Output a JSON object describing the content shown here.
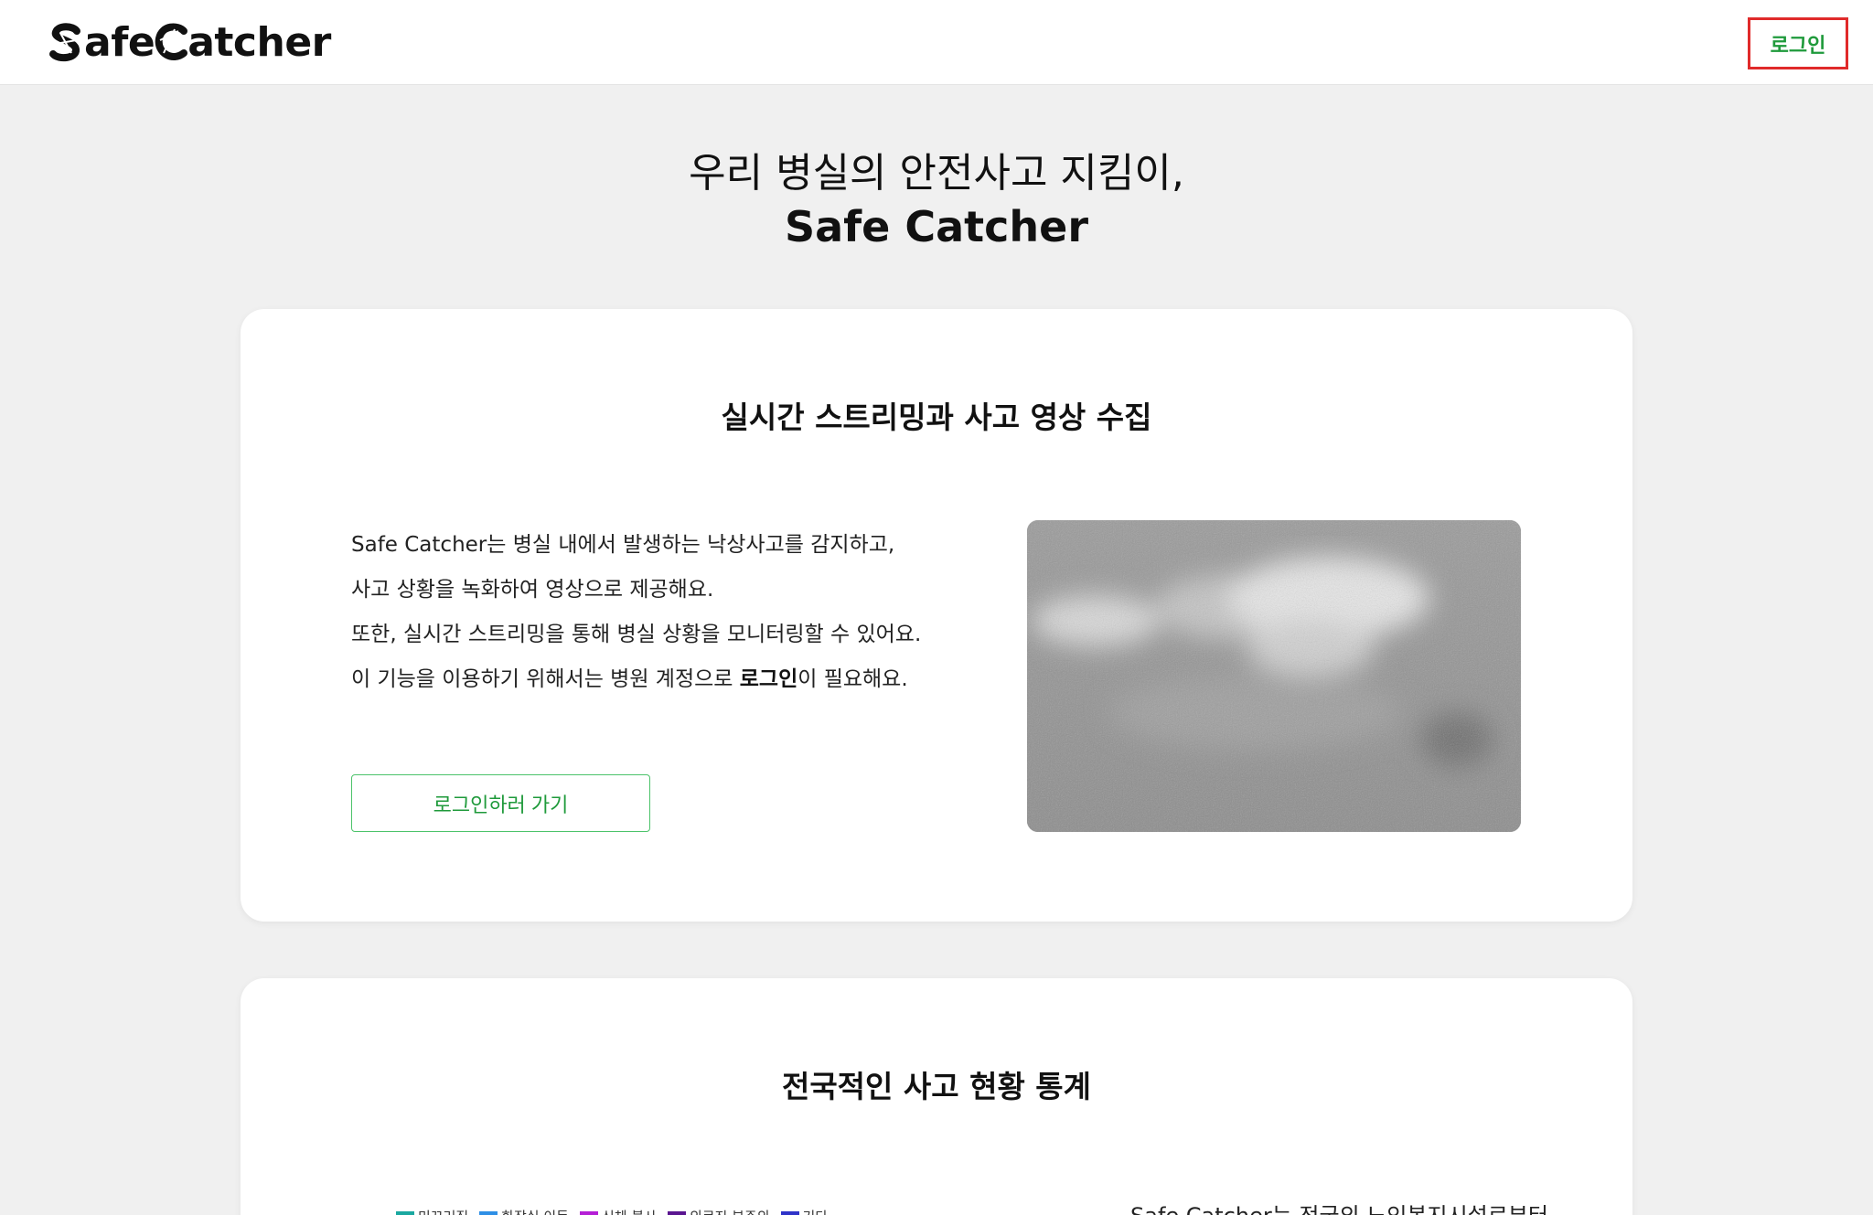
{
  "header": {
    "logo_text": "Safe Catcher",
    "login_label": "로그인"
  },
  "hero": {
    "line1": "우리 병실의 안전사고 지킴이,",
    "line2": "Safe Catcher"
  },
  "feature_card": {
    "title": "실시간 스트리밍과 사고 영상 수집",
    "desc_line1": "Safe Catcher는 병실 내에서 발생하는 낙상사고를 감지하고,",
    "desc_line2": "사고 상황을 녹화하여 영상으로 제공해요.",
    "desc_line3": "또한, 실시간 스트리밍을 통해 병실 상황을 모니터링할 수 있어요.",
    "desc_line4_pre": "이 기능을 이용하기 위해서는 병원 계정으로 ",
    "desc_line4_bold": "로그인",
    "desc_line4_post": "이 필요해요.",
    "cta_label": "로그인하러 가기"
  },
  "stats_card": {
    "title": "전국적인 사고 현황 통계",
    "legend": [
      {
        "label": "미끄러짐",
        "color": "#1aa8a0"
      },
      {
        "label": "화장실 이동",
        "color": "#2e8fe6"
      },
      {
        "label": "신체 불사",
        "color": "#b51fd6"
      },
      {
        "label": "의료진 부주의",
        "color": "#5a1590"
      },
      {
        "label": "기타",
        "color": "#2f33c8"
      }
    ],
    "text_partial": "Safe Catcher는 전국의 노인복지시설로부터"
  },
  "colors": {
    "accent_green": "#1f9a3b",
    "highlight_red": "#e02a2a",
    "page_bg": "#f0f0f0"
  }
}
